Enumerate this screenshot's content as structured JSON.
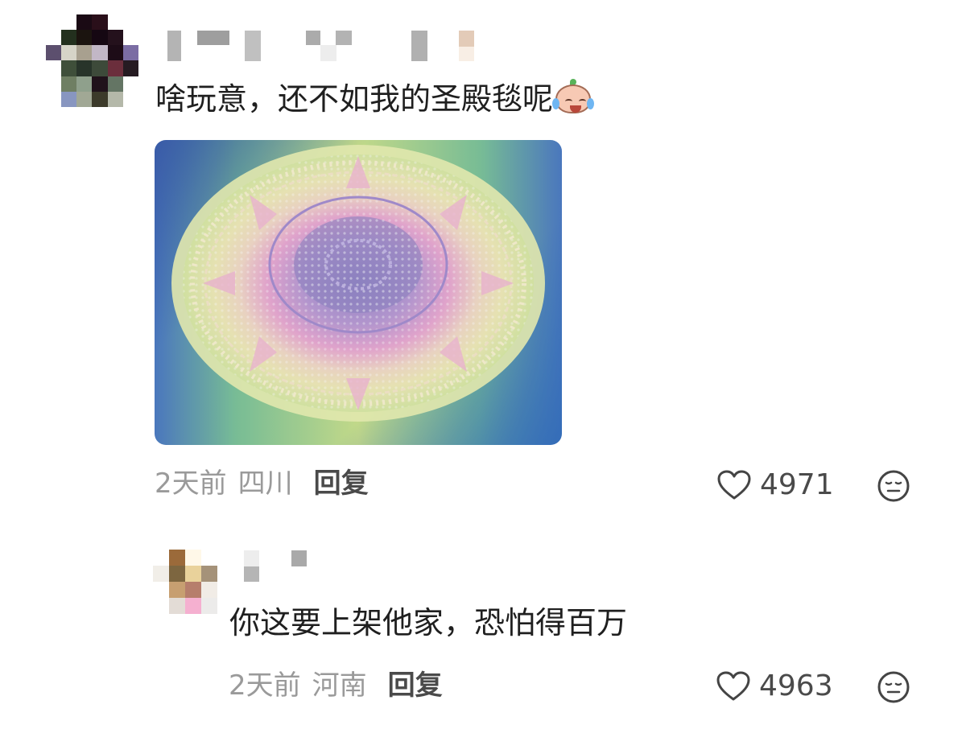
{
  "comment": {
    "text": "啥玩意，还不如我的圣殿毯呢",
    "emoji": "crying-laughing-face",
    "image": "crochet-mandala-blanket",
    "time": "2天前",
    "location": "四川",
    "reply_label": "回复",
    "likes": "4971"
  },
  "reply": {
    "text": "你这要上架他家，恐怕得百万",
    "time": "2天前",
    "location": "河南",
    "reply_label": "回复",
    "likes": "4963"
  },
  "colors": {
    "meta_gray": "#9a9a9a",
    "reply_button": "#4a4a4a",
    "text": "#1f1f1f"
  }
}
